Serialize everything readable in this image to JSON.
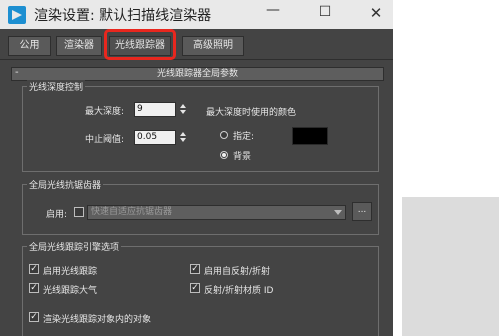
{
  "window": {
    "title": "渲染设置: 默认扫描线渲染器",
    "min_glyph": "—",
    "max_glyph": "☐",
    "close_glyph": "✕"
  },
  "tabs": [
    {
      "label": "公用"
    },
    {
      "label": "渲染器"
    },
    {
      "label": "光线跟踪器"
    },
    {
      "label": "高级照明"
    }
  ],
  "rollout": {
    "title": "光线跟踪器全局参数",
    "collapse_glyph": "-"
  },
  "depth_control": {
    "group_label": "光线深度控制",
    "max_depth_label": "最大深度:",
    "max_depth_value": "9",
    "cutoff_label": "中止阈值:",
    "cutoff_value": "0.05",
    "color_title": "最大深度时使用的颜色",
    "specify_label": "指定:",
    "background_label": "背景",
    "selected_option": "背景",
    "specify_color": "#000000"
  },
  "antialiaser": {
    "group_label": "全局光线抗锯齿器",
    "on_label": "启用:",
    "enabled": false,
    "dropdown_value": "快速自适应抗锯齿器",
    "more_button": "..."
  },
  "engine_options": {
    "group_label": "全局光线跟踪引擎选项",
    "items": [
      {
        "label": "启用光线跟踪",
        "checked": true
      },
      {
        "label": "启用自反射/折射",
        "checked": true
      },
      {
        "label": "光线跟踪大气",
        "checked": true
      },
      {
        "label": "反射/折射材质 ID",
        "checked": true
      },
      {
        "label": "渲染光线跟踪对象内的对象",
        "checked": true
      }
    ]
  },
  "colors": {
    "panel_bg": "#444444",
    "highlight": "#e8271e",
    "titlebar_bg": "#e9e9e9"
  }
}
